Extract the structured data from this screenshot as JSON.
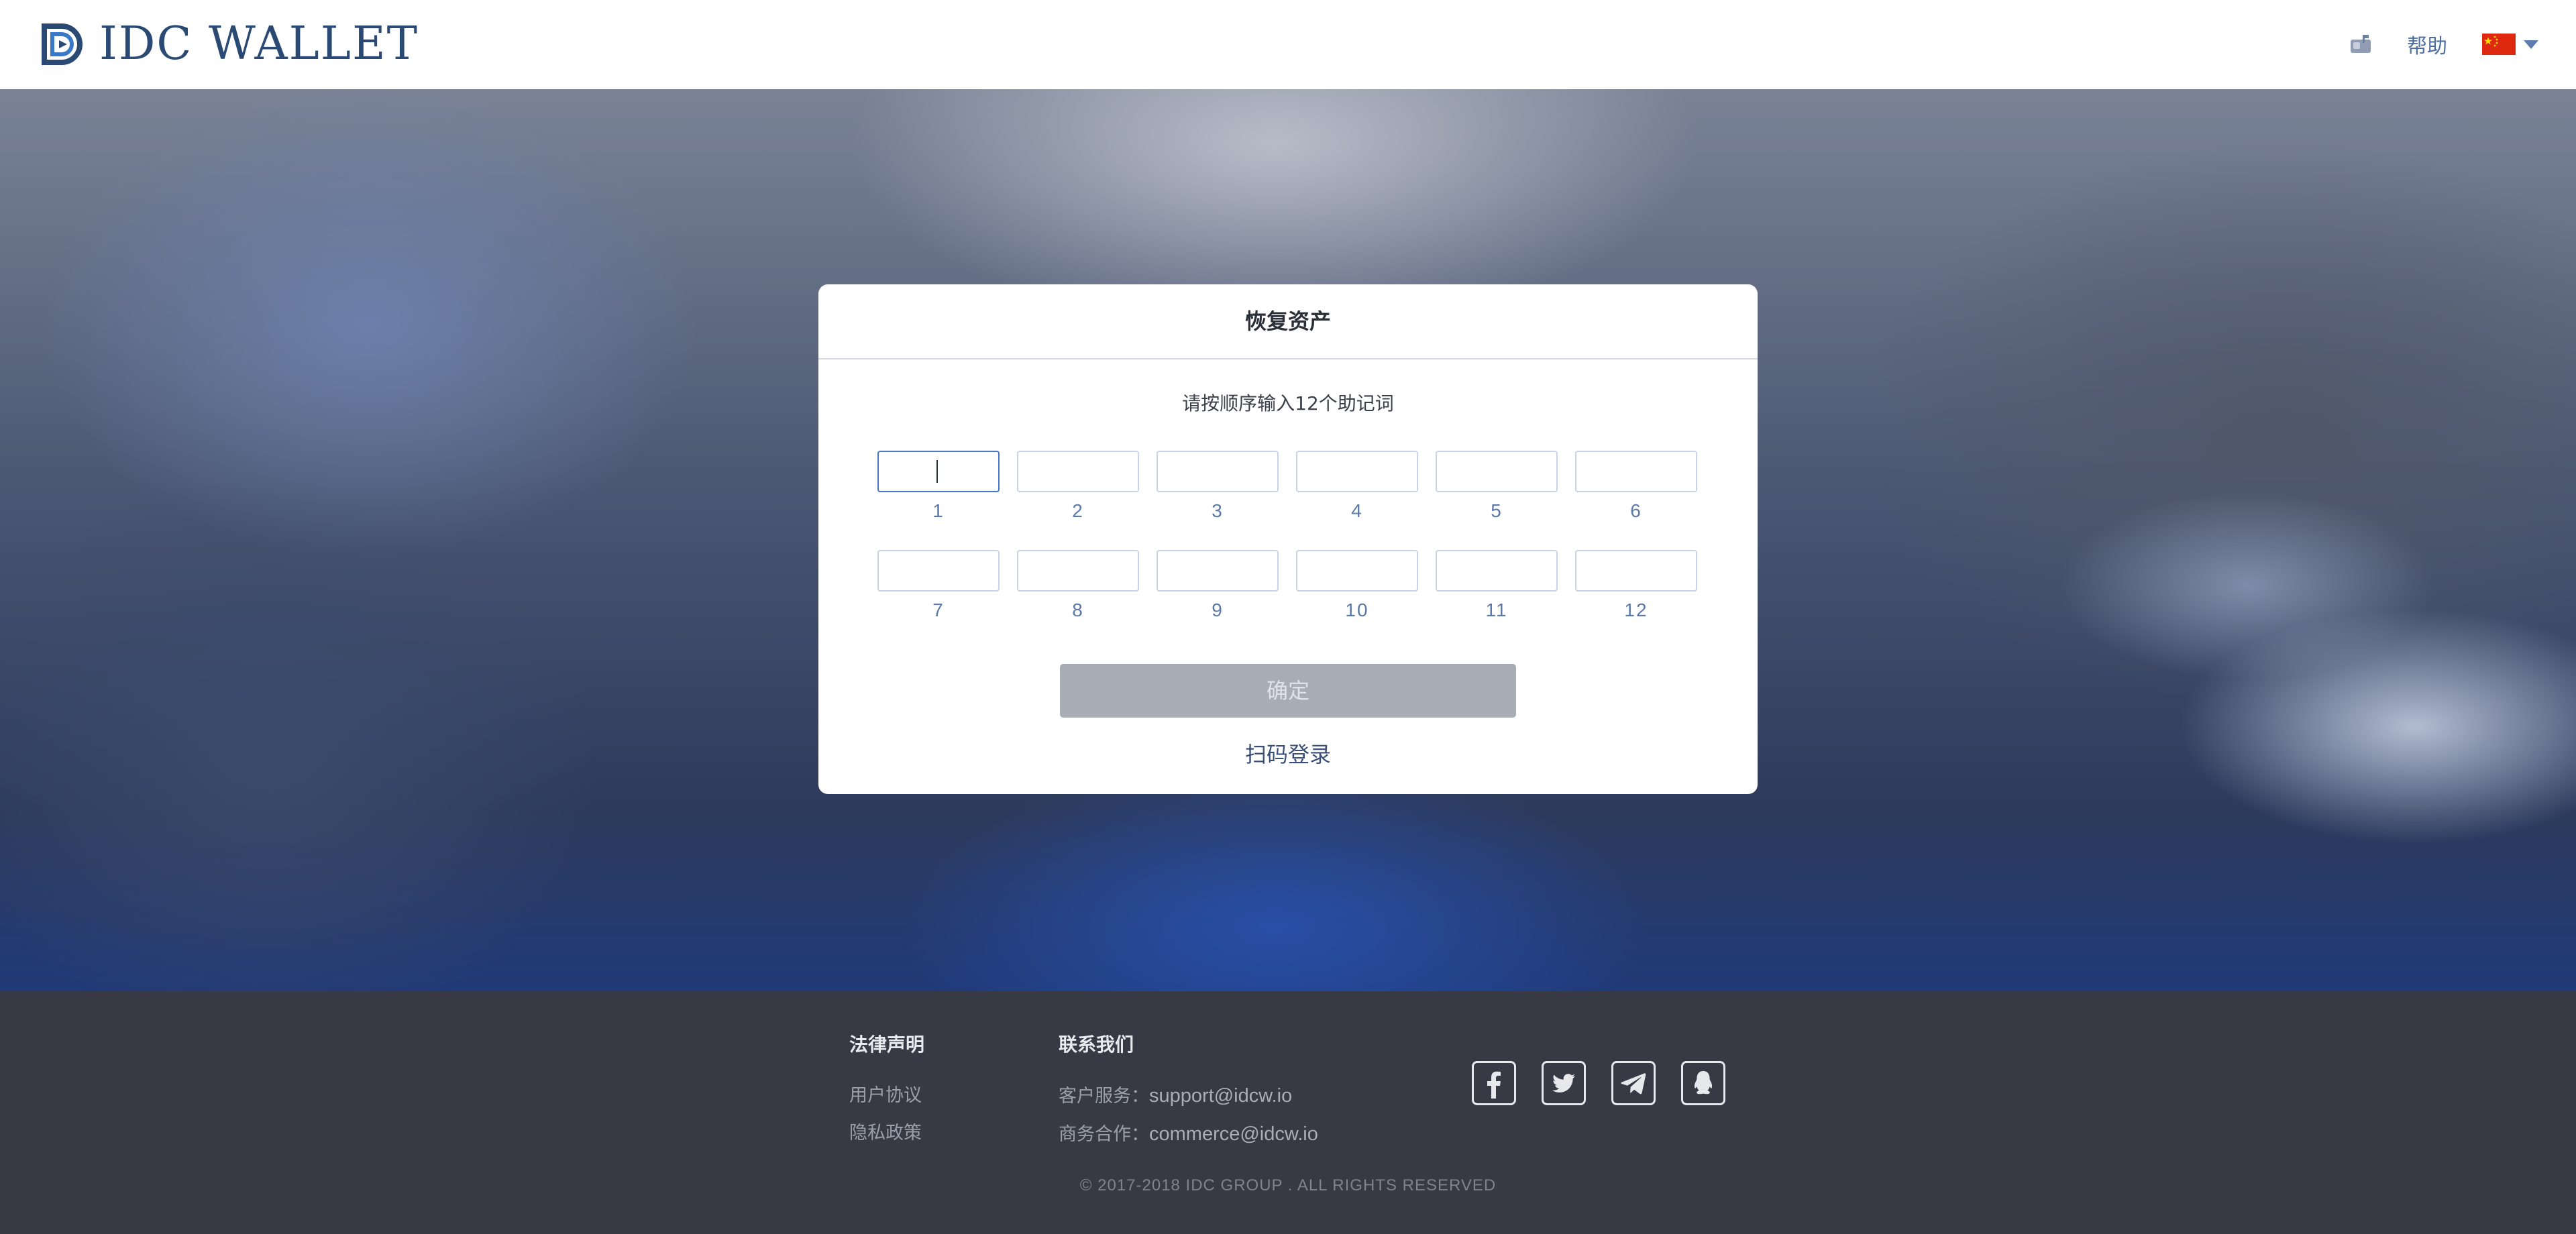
{
  "header": {
    "brand": "IDC WALLET",
    "help_label": "帮助",
    "language_flag": "cn-flag-icon",
    "icons": [
      "logo-mark",
      "mailbox-icon",
      "cn-flag-icon",
      "caret-down-icon"
    ]
  },
  "card": {
    "title": "恢复资产",
    "subtitle": "请按顺序输入12个助记词",
    "words": [
      {
        "num": "1",
        "value": ""
      },
      {
        "num": "2",
        "value": ""
      },
      {
        "num": "3",
        "value": ""
      },
      {
        "num": "4",
        "value": ""
      },
      {
        "num": "5",
        "value": ""
      },
      {
        "num": "6",
        "value": ""
      },
      {
        "num": "7",
        "value": ""
      },
      {
        "num": "8",
        "value": ""
      },
      {
        "num": "9",
        "value": ""
      },
      {
        "num": "10",
        "value": ""
      },
      {
        "num": "11",
        "value": ""
      },
      {
        "num": "12",
        "value": ""
      }
    ],
    "confirm_label": "确定",
    "qr_login_label": "扫码登录"
  },
  "footer": {
    "legal": {
      "title": "法律声明",
      "links": [
        "用户协议",
        "隐私政策"
      ]
    },
    "contact": {
      "title": "联系我们",
      "items": [
        {
          "label": "客户服务：",
          "value": "support@idcw.io"
        },
        {
          "label": "商务合作：",
          "value": "commerce@idcw.io"
        }
      ]
    },
    "socials": [
      "facebook-icon",
      "twitter-icon",
      "telegram-icon",
      "qq-icon"
    ],
    "copyright": "© 2017-2018 IDC GROUP . ALL RIGHTS RESERVED"
  },
  "colors": {
    "brand": "#2a4a73",
    "accent": "#4a76c8",
    "button_disabled": "#a7acb5",
    "footer_bg": "#373a44"
  }
}
